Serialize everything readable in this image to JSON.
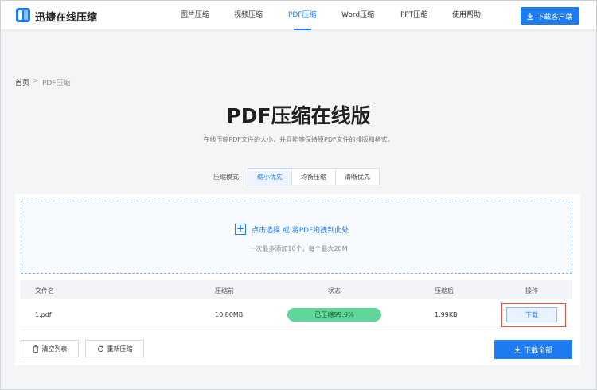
{
  "header": {
    "brand": "迅捷在线压缩",
    "nav": [
      {
        "label": "图片压缩",
        "active": false
      },
      {
        "label": "视频压缩",
        "active": false
      },
      {
        "label": "PDF压缩",
        "active": true
      },
      {
        "label": "Word压缩",
        "active": false
      },
      {
        "label": "PPT压缩",
        "active": false
      },
      {
        "label": "使用帮助",
        "active": false
      }
    ],
    "download_client": "下载客户端"
  },
  "breadcrumb": {
    "home": "首页",
    "separator": ">",
    "current": "PDF压缩"
  },
  "title": "PDF压缩在线版",
  "subtitle": "在线压缩PDF文件的大小，并且能够保持原PDF文件的排版和格式。",
  "mode": {
    "label": "压缩模式:",
    "options": [
      "缩小优先",
      "均衡压缩",
      "清晰优先"
    ],
    "selected": "缩小优先"
  },
  "upload": {
    "link_text": "点击选择 或 将PDF拖拽到此处",
    "hint": "一次最多添加10个，每个最大20M"
  },
  "table": {
    "headers": [
      "文件名",
      "压缩前",
      "状态",
      "压缩后",
      "操作"
    ],
    "rows": [
      {
        "name": "1.pdf",
        "before": "10.80MB",
        "status": "已压缩99.9%",
        "after": "1.99KB",
        "action": "下载"
      }
    ]
  },
  "actions": {
    "clear": "清空列表",
    "recompress": "重新压缩",
    "download_all": "下载全部"
  },
  "colors": {
    "accent": "#1d7cf2",
    "success": "#5fd79a",
    "highlight": "#e8553f"
  }
}
